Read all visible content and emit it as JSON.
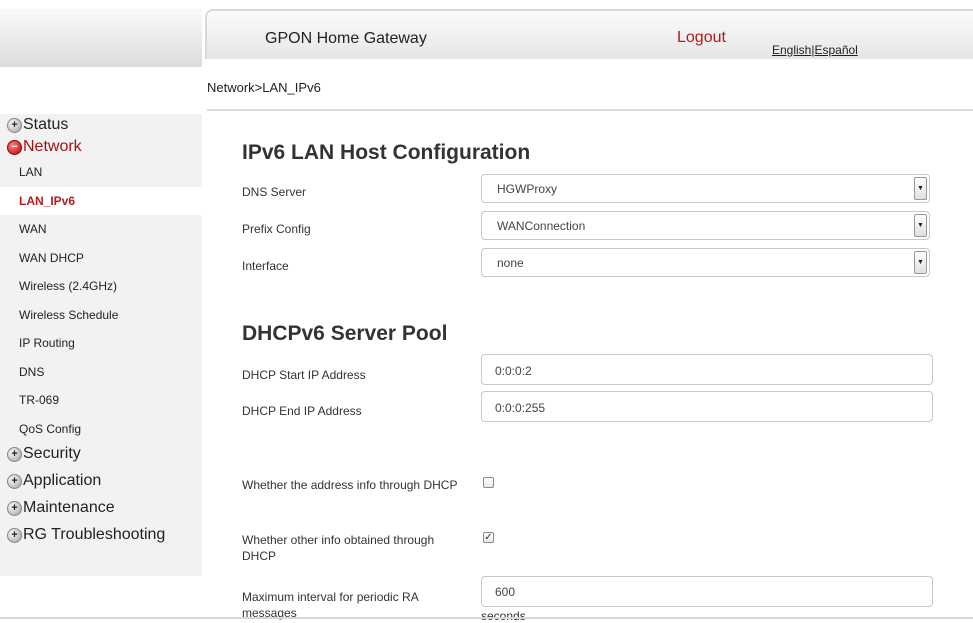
{
  "header": {
    "title": "GPON Home Gateway",
    "logout": "Logout",
    "lang_en": "English",
    "lang_sep": "|",
    "lang_es": "Español"
  },
  "breadcrumb": "Network>LAN_IPv6",
  "sidebar": {
    "groups_top": [
      {
        "label": "Status",
        "state": "collapsed"
      },
      {
        "label": "Network",
        "state": "expanded"
      }
    ],
    "network_items": [
      "LAN",
      "LAN_IPv6",
      "WAN",
      "WAN DHCP",
      "Wireless (2.4GHz)",
      "Wireless Schedule",
      "IP Routing",
      "DNS",
      "TR-069",
      "QoS Config"
    ],
    "active_item": "LAN_IPv6",
    "groups_bottom": [
      {
        "label": "Security",
        "state": "collapsed"
      },
      {
        "label": "Application",
        "state": "collapsed"
      },
      {
        "label": "Maintenance",
        "state": "collapsed"
      },
      {
        "label": "RG Troubleshooting",
        "state": "collapsed"
      }
    ]
  },
  "section_host": {
    "title": "IPv6 LAN Host Configuration",
    "dns_label": "DNS Server",
    "dns_value": "HGWProxy",
    "prefix_label": "Prefix Config",
    "prefix_value": "WANConnection",
    "interface_label": "Interface",
    "interface_value": "none"
  },
  "section_pool": {
    "title": "DHCPv6 Server Pool",
    "start_label": "DHCP Start IP Address",
    "start_value": "0:0:0:2",
    "end_label": "DHCP End IP Address",
    "end_value": "0:0:0:255"
  },
  "options": {
    "addr_dhcp_label": "Whether the address info through DHCP",
    "addr_dhcp_checked": false,
    "other_dhcp_label": "Whether other info obtained through DHCP",
    "other_dhcp_checked": true,
    "ra_label": "Maximum interval for periodic RA messages",
    "ra_value": "600",
    "ra_unit": "seconds"
  },
  "colors": {
    "accent_red": "#b11b1b",
    "sidebar_bg": "#f2f2f2"
  }
}
